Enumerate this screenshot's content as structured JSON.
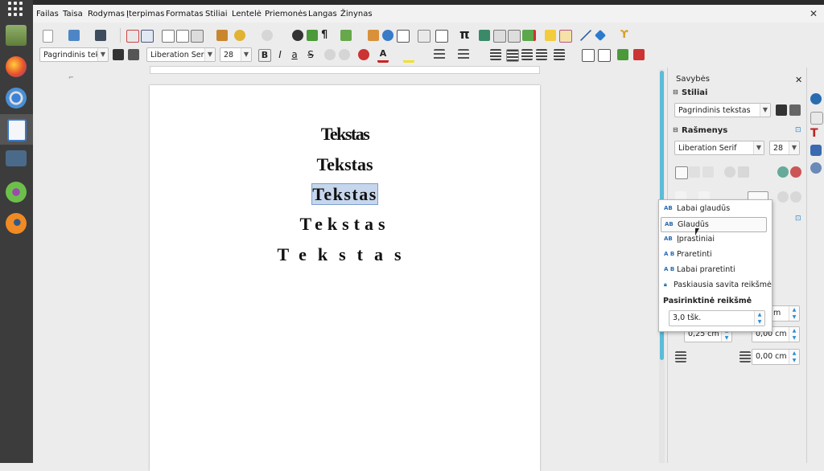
{
  "menu": [
    "Failas",
    "Taisa",
    "Rodymas",
    "Įterpimas",
    "Formatas",
    "Stiliai",
    "Lentelė",
    "Priemonės",
    "Langas",
    "Žinynas"
  ],
  "formatting": {
    "paragraph_style": "Pagrindinis teks",
    "font_name": "Liberation Serif",
    "font_size": "28"
  },
  "document": {
    "lines": [
      "Tekstas",
      "Tekstas",
      "Tekstas",
      "Tekstas",
      "Tekstas"
    ]
  },
  "sidebar": {
    "title": "Savybės",
    "styles_header": "Stiliai",
    "paragraph_style": "Pagrindinis tekstas",
    "font_header": "Rašmenys",
    "font_name": "Liberation Serif",
    "font_size": "28",
    "spin_values": [
      "m",
      "0,25 cm",
      "0,00 cm",
      "0,00 cm"
    ]
  },
  "spacing_popup": {
    "items": [
      "Labai glaudūs",
      "Glaudūs",
      "Įprastiniai",
      "Praretinti",
      "Labai praretinti"
    ],
    "last_custom": "Paskiausia savita reikšmė",
    "custom_header": "Pasirinktinė reikšmė",
    "custom_value": "3,0 tšk."
  },
  "colors": {
    "accent": "#2a8bd0",
    "selection": "#c6d6ec",
    "scrollbar": "#5bbcd9"
  }
}
